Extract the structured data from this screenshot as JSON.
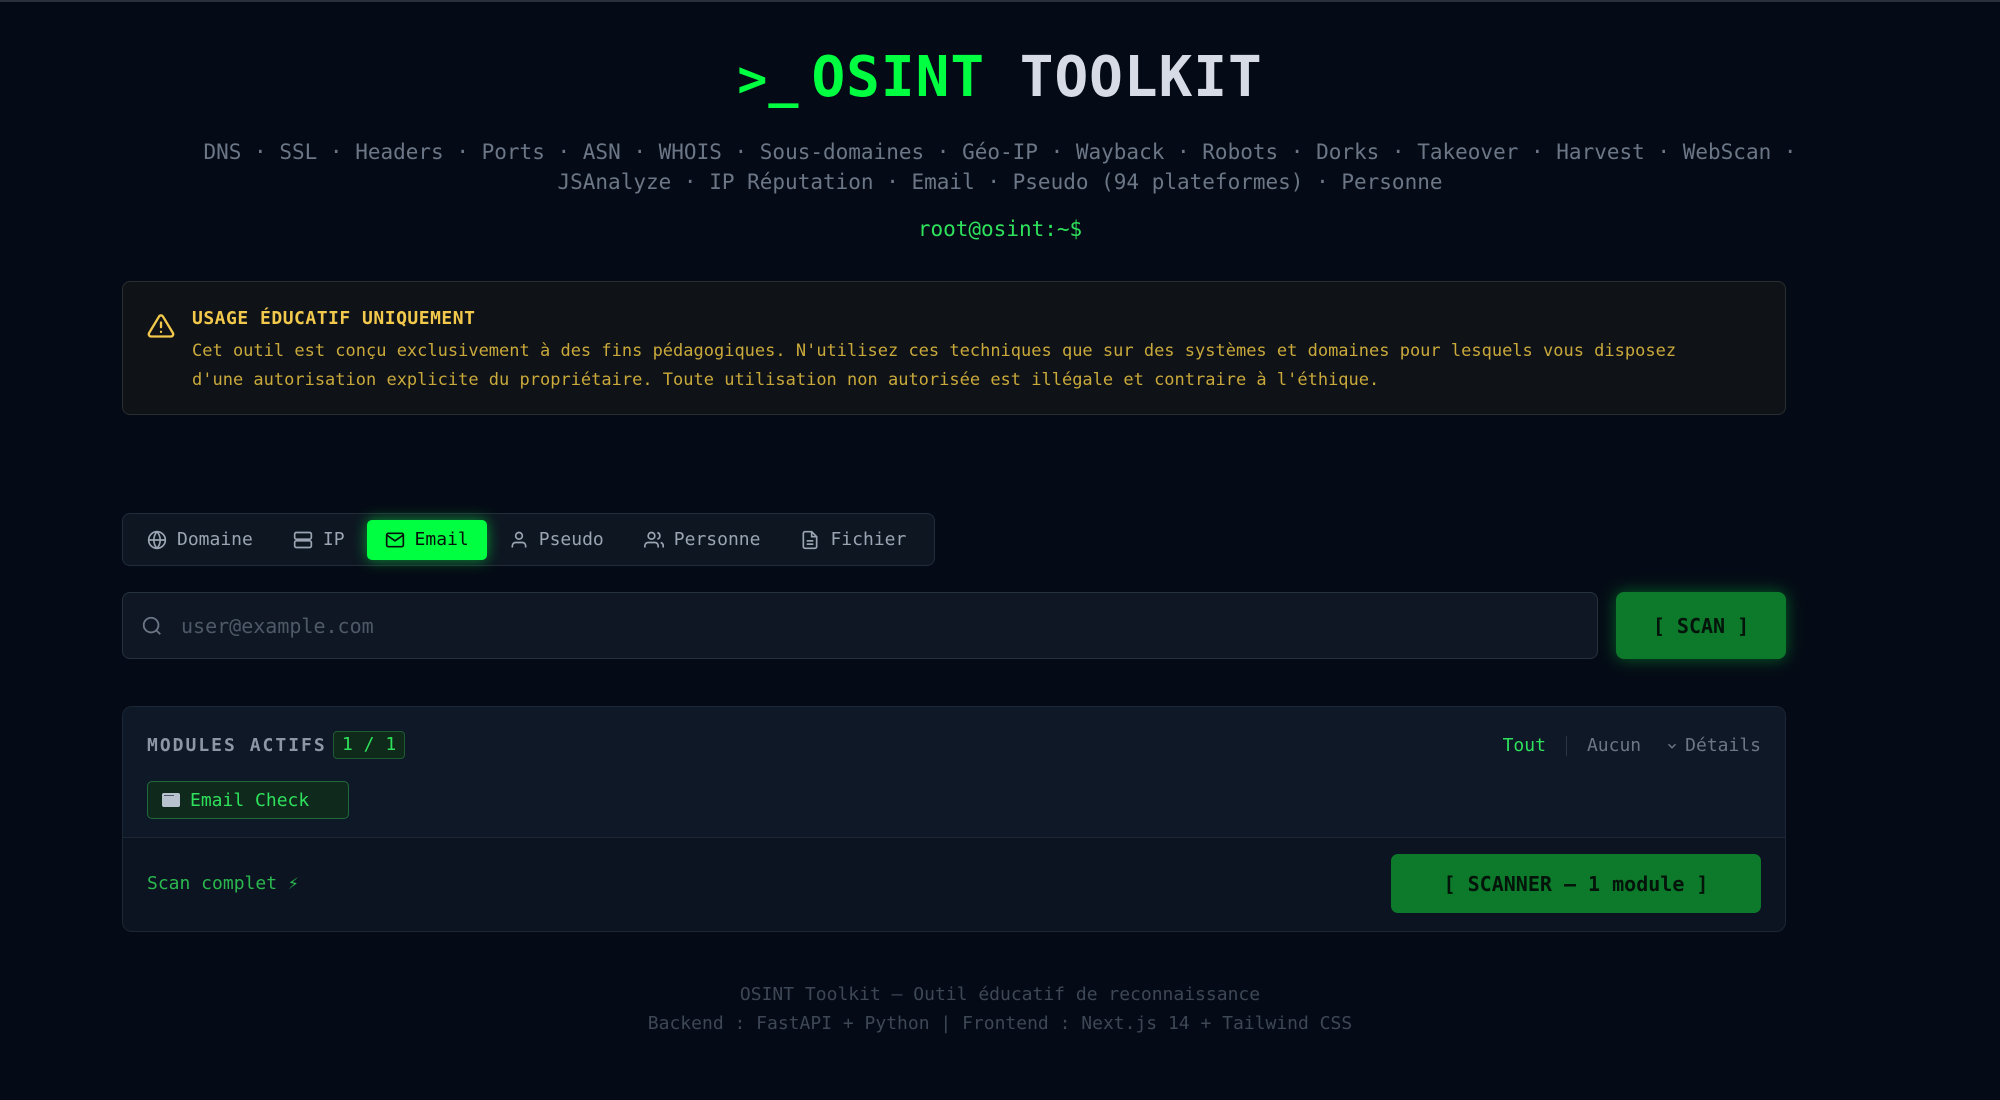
{
  "header": {
    "prompt_symbol": ">_",
    "title_part1": "OSINT",
    "title_part2": "TOOLKIT",
    "modules_line1": "DNS · SSL · Headers · Ports · ASN · WHOIS · Sous-domaines · Géo-IP · Wayback · Robots · Dorks · Takeover · Harvest · WebScan ·",
    "modules_line2": "JSAnalyze · IP Réputation · Email · Pseudo (94 plateformes) · Personne",
    "root_prompt": "root@osint:~$"
  },
  "warning": {
    "title": "USAGE ÉDUCATIF UNIQUEMENT",
    "line1": "Cet outil est conçu exclusivement à des fins pédagogiques. N'utilisez ces techniques que sur des systèmes et domaines pour lesquels vous disposez",
    "line2": "d'une autorisation explicite du propriétaire. Toute utilisation non autorisée est illégale et contraire à l'éthique.",
    "icon": "warning-triangle-icon"
  },
  "tabs": [
    {
      "label": "Domaine",
      "icon": "globe-icon",
      "active": false
    },
    {
      "label": "IP",
      "icon": "server-icon",
      "active": false
    },
    {
      "label": "Email",
      "icon": "mail-icon",
      "active": true
    },
    {
      "label": "Pseudo",
      "icon": "user-icon",
      "active": false
    },
    {
      "label": "Personne",
      "icon": "users-icon",
      "active": false
    },
    {
      "label": "Fichier",
      "icon": "file-icon",
      "active": false
    }
  ],
  "search": {
    "placeholder": "user@example.com",
    "value": "",
    "scan_label": "[ SCAN ]"
  },
  "modules": {
    "label": "MODULES ACTIFS",
    "count": "1 / 1",
    "select_all": "Tout",
    "select_none": "Aucun",
    "details": "Détails",
    "items": [
      {
        "label": "Email Check",
        "icon": "envelope-icon"
      }
    ],
    "status": "Scan complet ⚡",
    "scanner_label": "[ SCANNER — 1 module ]"
  },
  "footer": {
    "line1": "OSINT Toolkit — Outil éducatif de reconnaissance",
    "line2": "Backend : FastAPI + Python | Frontend : Next.js 14 + Tailwind CSS"
  },
  "colors": {
    "background": "#050b16",
    "accent": "#00ff41",
    "warning": "#f2c94c",
    "button": "#0c7a2a"
  }
}
